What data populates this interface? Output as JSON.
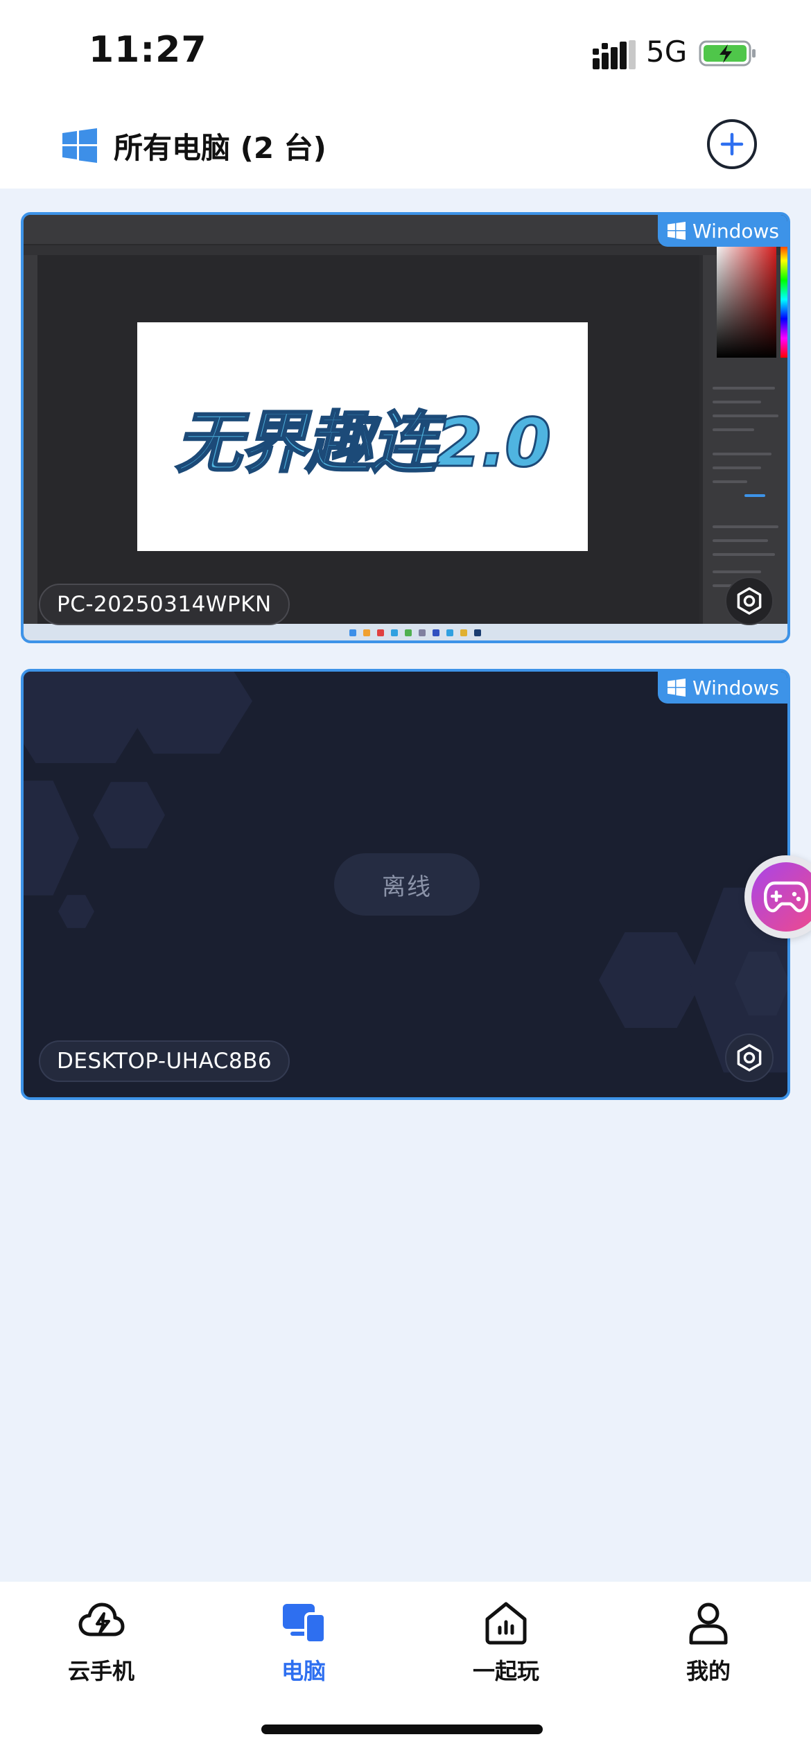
{
  "status_bar": {
    "time": "11:27",
    "network": "5G",
    "icons": [
      "signal-icon",
      "battery-charging-icon"
    ]
  },
  "header": {
    "title": "所有电脑 (2 台)",
    "logo_icon": "windows-logo-icon",
    "add_icon": "plus-circle-icon"
  },
  "devices": [
    {
      "name": "PC-20250314WPKN",
      "os_badge": "Windows",
      "preview_text": "无界趣连2.0",
      "status": "online"
    },
    {
      "name": "DESKTOP-UHAC8B6",
      "os_badge": "Windows",
      "status_text": "离线",
      "status": "offline"
    }
  ],
  "floating_button": {
    "icon": "gamepad-icon"
  },
  "tabbar": {
    "active": "电脑",
    "items": [
      {
        "label": "云手机",
        "icon": "cloud-phone-icon"
      },
      {
        "label": "电脑",
        "icon": "computer-icon"
      },
      {
        "label": "一起玩",
        "icon": "home-play-icon"
      },
      {
        "label": "我的",
        "icon": "user-icon"
      }
    ]
  },
  "colors": {
    "accent": "#3d93e8",
    "tab_active": "#2e6ff0",
    "background": "#ecf2fb",
    "offline_card": "#1a1f30"
  }
}
